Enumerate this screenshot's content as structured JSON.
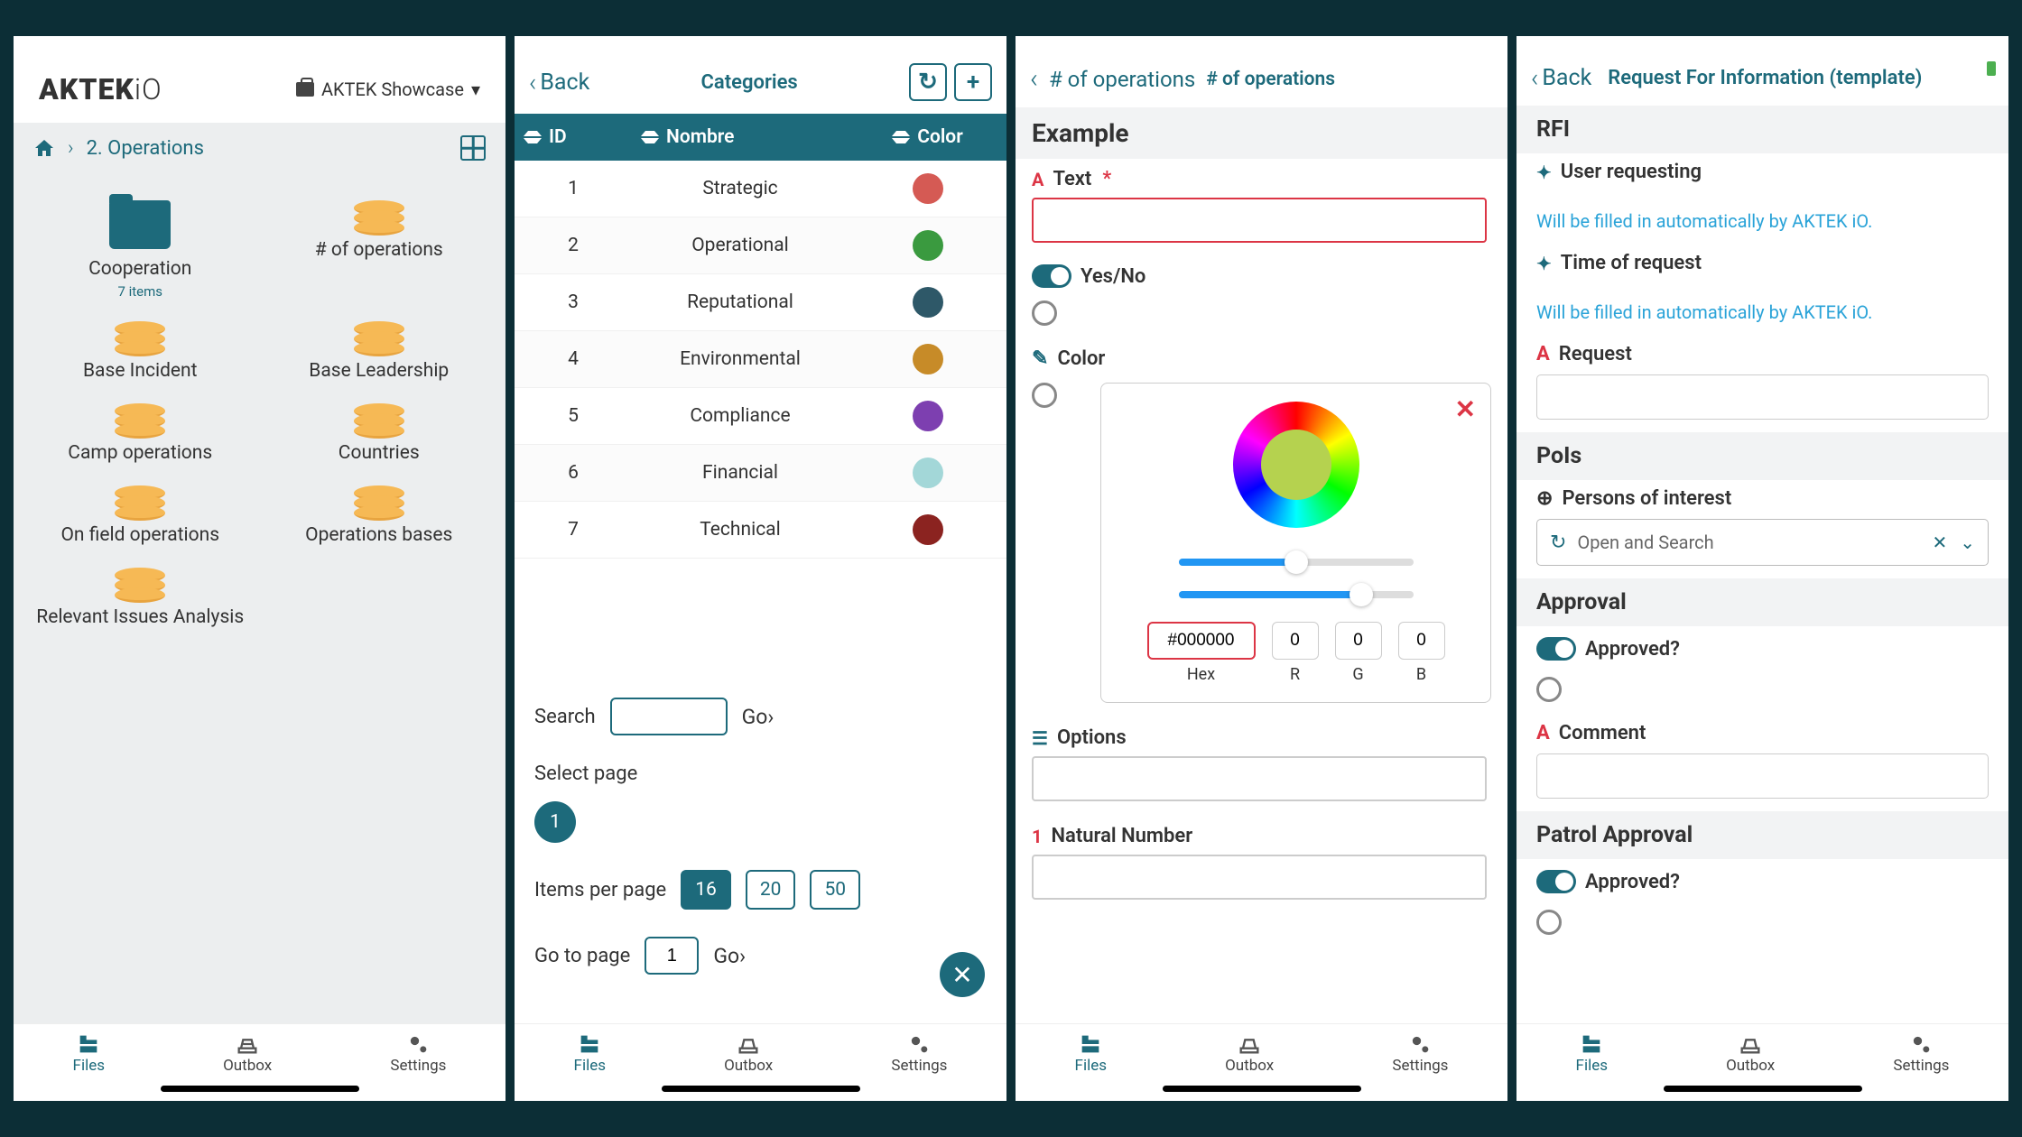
{
  "screen1": {
    "logo": "AKTEKiO",
    "showcase": "AKTEK Showcase",
    "breadcrumb": "2. Operations",
    "items": [
      {
        "name": "Cooperation",
        "sub": "7 items",
        "type": "folder"
      },
      {
        "name": "# of operations",
        "type": "db"
      },
      {
        "name": "Base Incident",
        "type": "db"
      },
      {
        "name": "Base Leadership",
        "type": "db"
      },
      {
        "name": "Camp operations",
        "type": "db"
      },
      {
        "name": "Countries",
        "type": "db"
      },
      {
        "name": "On field operations",
        "type": "db"
      },
      {
        "name": "Operations bases",
        "type": "db"
      },
      {
        "name": "Relevant Issues Analysis",
        "type": "db"
      }
    ]
  },
  "screen2": {
    "back": "Back",
    "title": "Categories",
    "cols": {
      "id": "ID",
      "name": "Nombre",
      "color": "Color"
    },
    "rows": [
      {
        "id": "1",
        "name": "Strategic",
        "color": "#d55a54"
      },
      {
        "id": "2",
        "name": "Operational",
        "color": "#3a9a3f"
      },
      {
        "id": "3",
        "name": "Reputational",
        "color": "#2e5868"
      },
      {
        "id": "4",
        "name": "Environmental",
        "color": "#c78b28"
      },
      {
        "id": "5",
        "name": "Compliance",
        "color": "#7d3fb0"
      },
      {
        "id": "6",
        "name": "Financial",
        "color": "#a3d7d8"
      },
      {
        "id": "7",
        "name": "Technical",
        "color": "#8b2320"
      }
    ],
    "search_label": "Search",
    "go": "Go",
    "select_page": "Select page",
    "page": "1",
    "items_per_page": "Items per page",
    "ipp_options": [
      "16",
      "20",
      "50"
    ],
    "ipp_active": "16",
    "goto": "Go to page",
    "goto_val": "1"
  },
  "screen3": {
    "bread_parent": "# of operations",
    "bread_cur": "# of operations",
    "section": "Example",
    "text_label": "Text",
    "yesno": "Yes/No",
    "color_label": "Color",
    "hex": "#000000",
    "r": "0",
    "g": "0",
    "b": "0",
    "hex_lab": "Hex",
    "r_lab": "R",
    "g_lab": "G",
    "b_lab": "B",
    "options_label": "Options",
    "natnum_label": "Natural Number"
  },
  "screen4": {
    "back": "Back",
    "title": "Request For Information (template)",
    "s1": "RFI",
    "user_req": "User requesting",
    "auto": "Will be filled in automatically by AKTEK iO.",
    "time_req": "Time of request",
    "request": "Request",
    "s2": "PoIs",
    "poi": "Persons of interest",
    "open_search": "Open and Search",
    "s3": "Approval",
    "approved": "Approved?",
    "comment": "Comment",
    "s4": "Patrol Approval"
  },
  "tabs": {
    "files": "Files",
    "outbox": "Outbox",
    "settings": "Settings"
  }
}
